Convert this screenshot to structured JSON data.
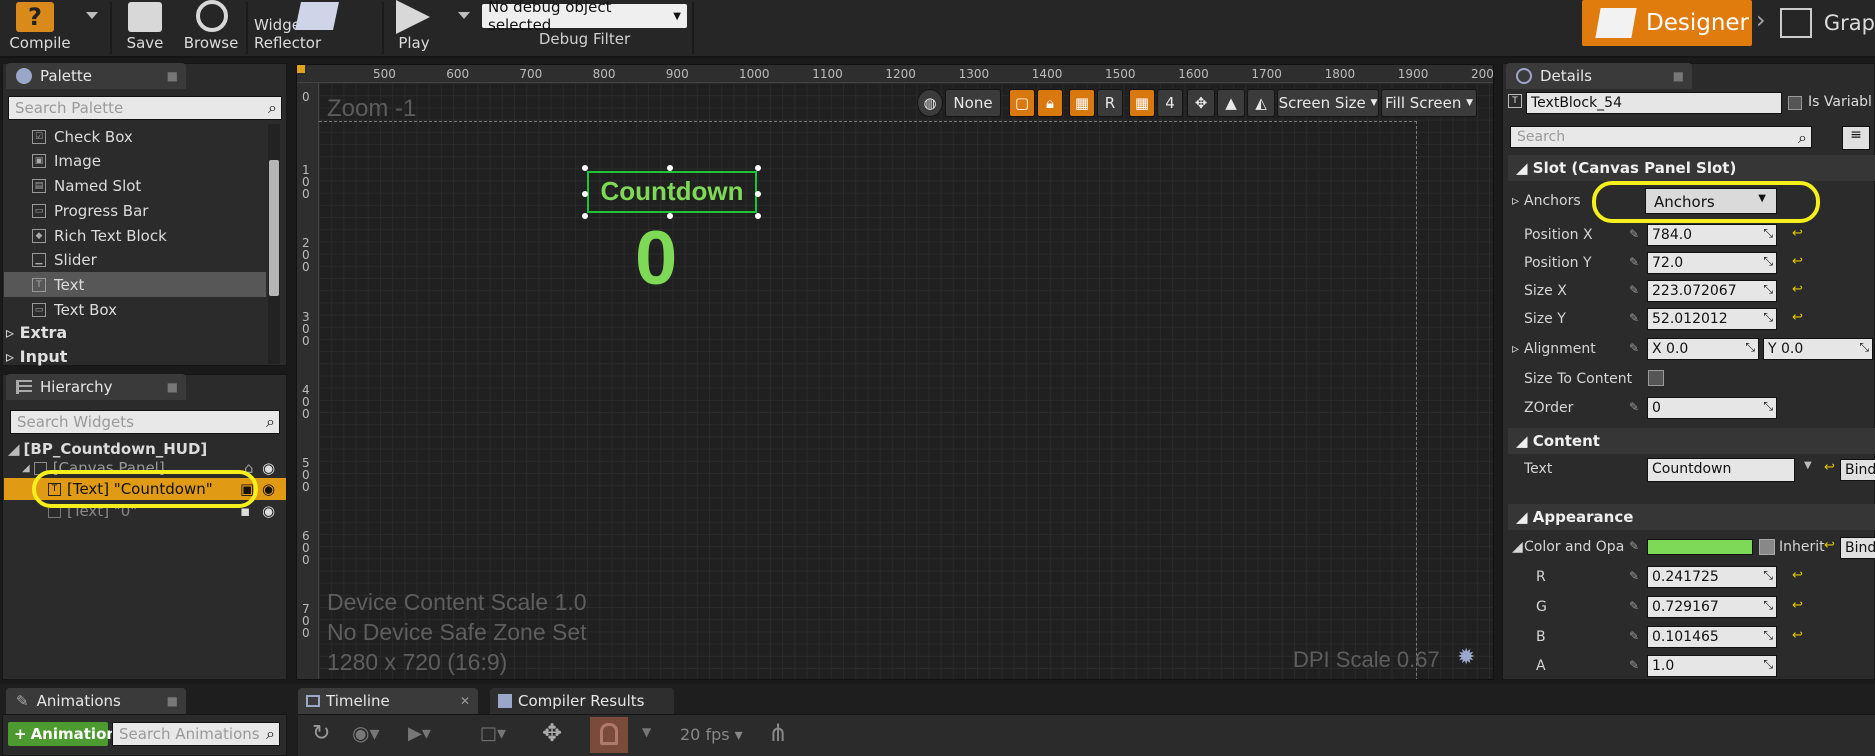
{
  "toolbar": {
    "compile": "Compile",
    "save": "Save",
    "browse": "Browse",
    "widget_reflector": "Widget Reflector",
    "play": "Play",
    "debug_object": "No debug object selected",
    "debug_filter": "Debug Filter",
    "designer": "Designer",
    "graph": "Grap"
  },
  "palette": {
    "tab": "Palette",
    "search_placeholder": "Search Palette",
    "items": [
      "Check Box",
      "Image",
      "Named Slot",
      "Progress Bar",
      "Rich Text Block",
      "Slider",
      "Text",
      "Text Box"
    ],
    "selected": "Text",
    "categories": [
      "Extra",
      "Input"
    ]
  },
  "hierarchy": {
    "tab": "Hierarchy",
    "search_placeholder": "Search Widgets",
    "root": "[BP_Countdown_HUD]",
    "canvas_panel": "[Canvas Panel]",
    "text_countdown": "[Text] \"Countdown\"",
    "text_zero": "[Text] \"0\""
  },
  "canvas": {
    "zoom": "Zoom -1",
    "ruler_x": [
      "500",
      "600",
      "700",
      "800",
      "900",
      "1000",
      "1100",
      "1200",
      "1300",
      "1400",
      "1500",
      "1600",
      "1700",
      "1800",
      "1900",
      "2000"
    ],
    "ruler_y": [
      "0",
      "100",
      "200",
      "300",
      "400",
      "500",
      "600",
      "700"
    ],
    "locale": "None",
    "r_button": "R",
    "grid_size": "4",
    "screen_size": "Screen Size",
    "fill_screen": "Fill Screen",
    "countdown_text": "Countdown",
    "zero_text": "0",
    "device_scale": "Device Content Scale 1.0",
    "safe_zone": "No Device Safe Zone Set",
    "resolution": "1280 x 720 (16:9)",
    "dpi": "DPI Scale 0.67",
    "text_color": "#7ed957"
  },
  "details": {
    "tab": "Details",
    "name": "TextBlock_54",
    "is_variable": "Is Variabl",
    "search_placeholder": "Search",
    "slot_section": "Slot (Canvas Panel Slot)",
    "anchors_label": "Anchors",
    "anchors_value": "Anchors",
    "position_x_label": "Position X",
    "position_x": "784.0",
    "position_y_label": "Position Y",
    "position_y": "72.0",
    "size_x_label": "Size X",
    "size_x": "223.072067",
    "size_y_label": "Size Y",
    "size_y": "52.012012",
    "alignment_label": "Alignment",
    "alignment_x": "X  0.0",
    "alignment_y": "Y  0.0",
    "size_to_content_label": "Size To Content",
    "zorder_label": "ZOrder",
    "zorder": "0",
    "content_section": "Content",
    "text_label": "Text",
    "text_value": "Countdown",
    "bind": "Bind",
    "appearance_section": "Appearance",
    "color_label": "Color and Opa",
    "inherit": "Inherit",
    "r_label": "R",
    "r": "0.241725",
    "g_label": "G",
    "g": "0.729167",
    "b_label": "B",
    "b": "0.101465",
    "a_label": "A",
    "a": "1.0"
  },
  "bottom": {
    "animations_tab": "Animations",
    "add_animation": "Animation",
    "search_animations": "Search Animations",
    "timeline_tab": "Timeline",
    "compiler_tab": "Compiler Results",
    "fps": "20 fps"
  }
}
